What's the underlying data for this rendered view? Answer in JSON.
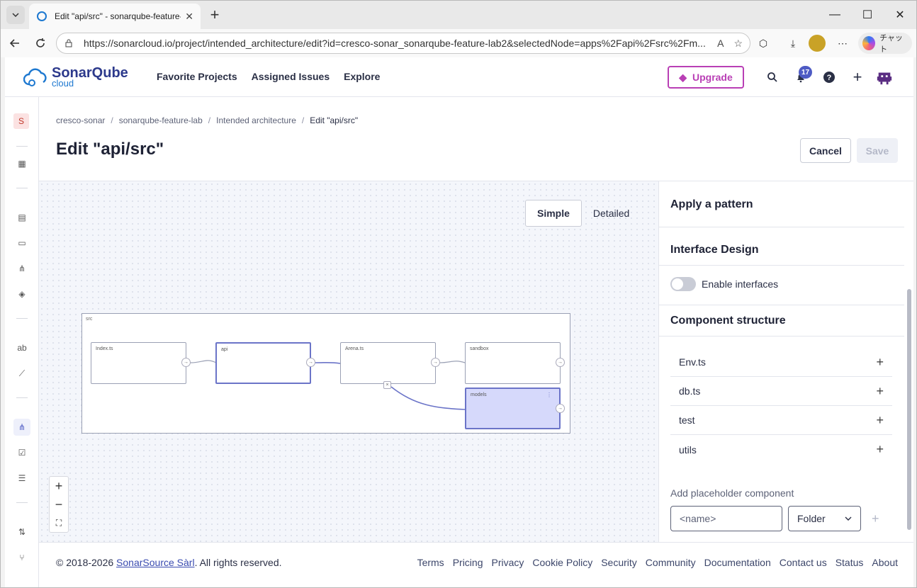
{
  "browser": {
    "tab_title": "Edit \"api/src\" - sonarqube-feature-",
    "url": "https://sonarcloud.io/project/intended_architecture/edit?id=cresco-sonar_sonarqube-feature-lab2&selectedNode=apps%2Fapi%2Fsrc%2Fm...",
    "copilot_label": "チャット"
  },
  "brand": {
    "name": "SonarQube",
    "sub": "cloud"
  },
  "nav": {
    "favorite": "Favorite Projects",
    "assigned": "Assigned Issues",
    "explore": "Explore"
  },
  "header": {
    "upgrade": "Upgrade",
    "notification_count": "17"
  },
  "sidebar": {
    "org_initial": "S"
  },
  "breadcrumbs": [
    "cresco-sonar",
    "sonarqube-feature-lab",
    "Intended architecture",
    "Edit \"api/src\""
  ],
  "page": {
    "title": "Edit \"api/src\"",
    "cancel": "Cancel",
    "save": "Save"
  },
  "view_modes": {
    "simple": "Simple",
    "detailed": "Detailed"
  },
  "diagram": {
    "container": "src",
    "nodes": [
      "Index.ts",
      "api",
      "Arena.ts",
      "sandbox",
      "models"
    ]
  },
  "panel": {
    "apply_pattern": "Apply a pattern",
    "interface_design": "Interface Design",
    "enable_interfaces": "Enable interfaces",
    "component_structure": "Component structure",
    "components": [
      "Env.ts",
      "db.ts",
      "test",
      "utils"
    ],
    "add_placeholder": "Add placeholder component",
    "name_placeholder": "<name>",
    "type_selected": "Folder"
  },
  "footer": {
    "copyright_prefix": "© 2018-2026",
    "company": "SonarSource Sàrl",
    "copyright_suffix": ". All rights reserved.",
    "links": [
      "Terms",
      "Pricing",
      "Privacy",
      "Cookie Policy",
      "Security",
      "Community",
      "Documentation",
      "Contact us",
      "Status",
      "About"
    ]
  },
  "colors": {
    "accent": "#4e5bc4",
    "upgrade": "#b93fb5",
    "node_selected": "#d6d9fb"
  }
}
